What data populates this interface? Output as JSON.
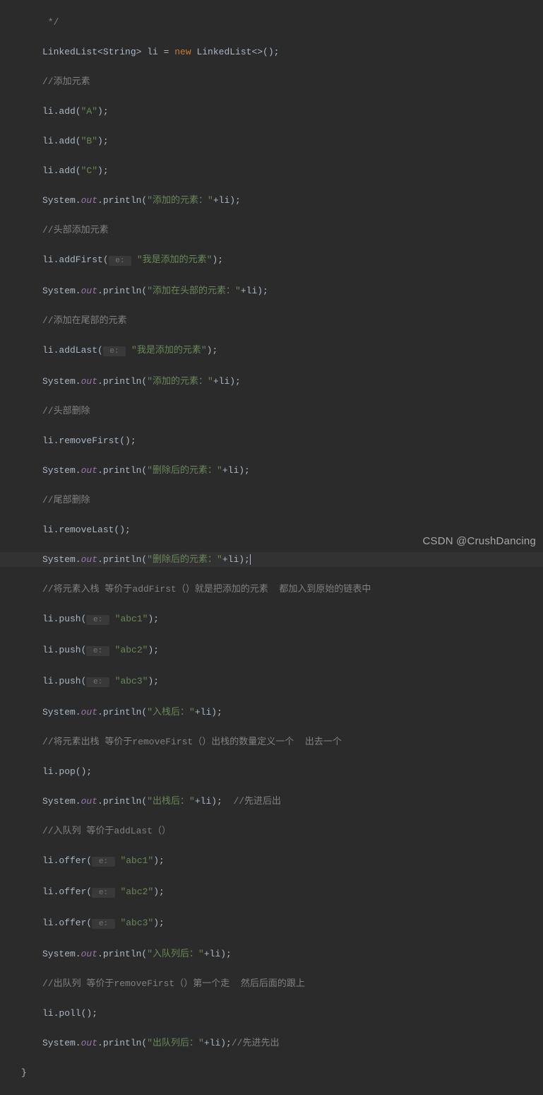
{
  "colors": {
    "background": "#2b2b2b",
    "text": "#a9b7c6",
    "keyword": "#cc7832",
    "string": "#6a8759",
    "comment": "#808080",
    "field": "#9876aa"
  },
  "watermark": "CSDN @CrushDancing",
  "code": {
    "l0": " */",
    "l1_a": "LinkedList<String> li = ",
    "l1_b": "new",
    "l1_c": " LinkedList<>();",
    "l2": "//添加元素",
    "l3_a": "li.add(",
    "l3_b": "\"A\"",
    "l3_c": ");",
    "l4_a": "li.add(",
    "l4_b": "\"B\"",
    "l4_c": ");",
    "l5_a": "li.add(",
    "l5_b": "\"C\"",
    "l5_c": ");",
    "l6_a": "System.",
    "l6_b": "out",
    "l6_c": ".println(",
    "l6_d": "\"添加的元素：\"",
    "l6_e": "+li);",
    "l7": "//头部添加元素",
    "l8_a": "li.addFirst(",
    "l8_p": " e: ",
    "l8_b": "\"我是添加的元素\"",
    "l8_c": ");",
    "l9_a": "System.",
    "l9_b": "out",
    "l9_c": ".println(",
    "l9_d": "\"添加在头部的元素：\"",
    "l9_e": "+li);",
    "l10": "//添加在尾部的元素",
    "l11_a": "li.addLast(",
    "l11_p": " e: ",
    "l11_b": "\"我是添加的元素\"",
    "l11_c": ");",
    "l12_a": "System.",
    "l12_b": "out",
    "l12_c": ".println(",
    "l12_d": "\"添加的元素：\"",
    "l12_e": "+li);",
    "l13": "//头部删除",
    "l14": "li.removeFirst();",
    "l15_a": "System.",
    "l15_b": "out",
    "l15_c": ".println(",
    "l15_d": "\"删除后的元素：\"",
    "l15_e": "+li);",
    "l16": "//尾部删除",
    "l17": "li.removeLast();",
    "l18_a": "System.",
    "l18_b": "out",
    "l18_c": ".println(",
    "l18_d": "\"删除后的元素：\"",
    "l18_e": "+li);",
    "l19": "//将元素入栈 等价于addFirst（）就是把添加的元素  都加入到原始的链表中",
    "l20_a": "li.push(",
    "l20_p": " e: ",
    "l20_b": "\"abc1\"",
    "l20_c": ");",
    "l21_a": "li.push(",
    "l21_p": " e: ",
    "l21_b": "\"abc2\"",
    "l21_c": ");",
    "l22_a": "li.push(",
    "l22_p": " e: ",
    "l22_b": "\"abc3\"",
    "l22_c": ");",
    "l23_a": "System.",
    "l23_b": "out",
    "l23_c": ".println(",
    "l23_d": "\"入栈后：\"",
    "l23_e": "+li);",
    "l24": "//将元素出栈 等价于removeFirst（）出栈的数量定义一个  出去一个",
    "l25": "li.pop();",
    "l26_a": "System.",
    "l26_b": "out",
    "l26_c": ".println(",
    "l26_d": "\"出栈后：\"",
    "l26_e": "+li);  ",
    "l26_f": "//先进后出",
    "l27": "//入队列 等价于addLast（）",
    "l28_a": "li.offer(",
    "l28_p": " e: ",
    "l28_b": "\"abc1\"",
    "l28_c": ");",
    "l29_a": "li.offer(",
    "l29_p": " e: ",
    "l29_b": "\"abc2\"",
    "l29_c": ");",
    "l30_a": "li.offer(",
    "l30_p": " e: ",
    "l30_b": "\"abc3\"",
    "l30_c": ");",
    "l31_a": "System.",
    "l31_b": "out",
    "l31_c": ".println(",
    "l31_d": "\"入队列后：\"",
    "l31_e": "+li);",
    "l32": "//出队列 等价于removeFirst（）第一个走  然后后面的跟上",
    "l33": "li.poll();",
    "l34_a": "System.",
    "l34_b": "out",
    "l34_c": ".println(",
    "l34_d": "\"出队列后：\"",
    "l34_e": "+li);",
    "l34_f": "//先进先出",
    "l35": "}"
  }
}
